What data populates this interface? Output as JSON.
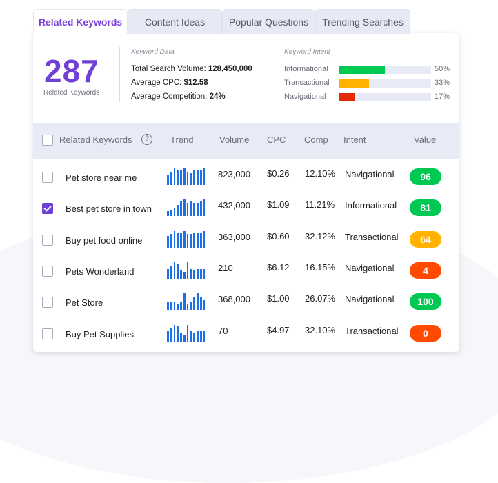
{
  "tabs": [
    {
      "label": "Related Keywords",
      "active": true
    },
    {
      "label": "Content Ideas",
      "active": false
    },
    {
      "label": "Popular Questions",
      "active": false
    },
    {
      "label": "Trending Searches",
      "active": false
    }
  ],
  "summary": {
    "count": "287",
    "count_label": "Related Keywords",
    "keyword_data": {
      "title": "Keyword Data",
      "total_search_volume_label": "Total Search Volume:",
      "total_search_volume": "128,450,000",
      "average_cpc_label": "Average CPC:",
      "average_cpc": "$12.58",
      "average_competition_label": "Average Competition:",
      "average_competition": "24%"
    },
    "keyword_intent": {
      "title": "Keyword Intent",
      "items": [
        {
          "label": "Informational",
          "percent": 50,
          "percent_text": "50%",
          "color": "#00c853"
        },
        {
          "label": "Transactional",
          "percent": 33,
          "percent_text": "33%",
          "color": "#ffb300"
        },
        {
          "label": "Navigational",
          "percent": 17,
          "percent_text": "17%",
          "color": "#e52a0a"
        }
      ]
    }
  },
  "table": {
    "headers": {
      "keyword": "Related Keywords",
      "help_icon": "?",
      "trend": "Trend",
      "volume": "Volume",
      "cpc": "CPC",
      "comp": "Comp",
      "intent": "Intent",
      "value": "Value"
    },
    "rows": [
      {
        "keyword": "Pet store near me",
        "checked": false,
        "trend": [
          6,
          8,
          10,
          9,
          9,
          10,
          8,
          7,
          9,
          9,
          9,
          10
        ],
        "volume": "823,000",
        "cpc": "$0.26",
        "comp": "12.10%",
        "intent": "Navigational",
        "value": "96",
        "value_color": "#00c853"
      },
      {
        "keyword": "Best pet store in town",
        "checked": true,
        "trend": [
          3,
          4,
          5,
          7,
          9,
          10,
          8,
          9,
          8,
          8,
          9,
          10
        ],
        "volume": "432,000",
        "cpc": "$1.09",
        "comp": "11.21%",
        "intent": "Informational",
        "value": "81",
        "value_color": "#00c853"
      },
      {
        "keyword": "Buy pet food online",
        "checked": false,
        "trend": [
          7,
          8,
          10,
          9,
          9,
          10,
          8,
          8,
          9,
          9,
          9,
          10
        ],
        "volume": "363,000",
        "cpc": "$0.60",
        "comp": "32.12%",
        "intent": "Transactional",
        "value": "64",
        "value_color": "#ffb300"
      },
      {
        "keyword": "Pets Wonderland",
        "checked": false,
        "trend": [
          6,
          8,
          10,
          9,
          5,
          4,
          10,
          6,
          5,
          6,
          6,
          6
        ],
        "volume": "210",
        "cpc": "$6.12",
        "comp": "16.15%",
        "intent": "Navigational",
        "value": "4",
        "value_color": "#ff4a00"
      },
      {
        "keyword": "Pet Store",
        "checked": false,
        "trend": [
          5,
          5,
          5,
          4,
          5,
          10,
          4,
          5,
          8,
          10,
          8,
          6
        ],
        "volume": "368,000",
        "cpc": "$1.00",
        "comp": "26.07%",
        "intent": "Navigational",
        "value": "100",
        "value_color": "#00c853"
      },
      {
        "keyword": "Buy Pet Supplies",
        "checked": false,
        "trend": [
          6,
          8,
          10,
          9,
          5,
          4,
          10,
          6,
          5,
          6,
          6,
          6
        ],
        "volume": "70",
        "cpc": "$4.97",
        "comp": "32.10%",
        "intent": "Transactional",
        "value": "0",
        "value_color": "#ff4a00"
      }
    ]
  }
}
